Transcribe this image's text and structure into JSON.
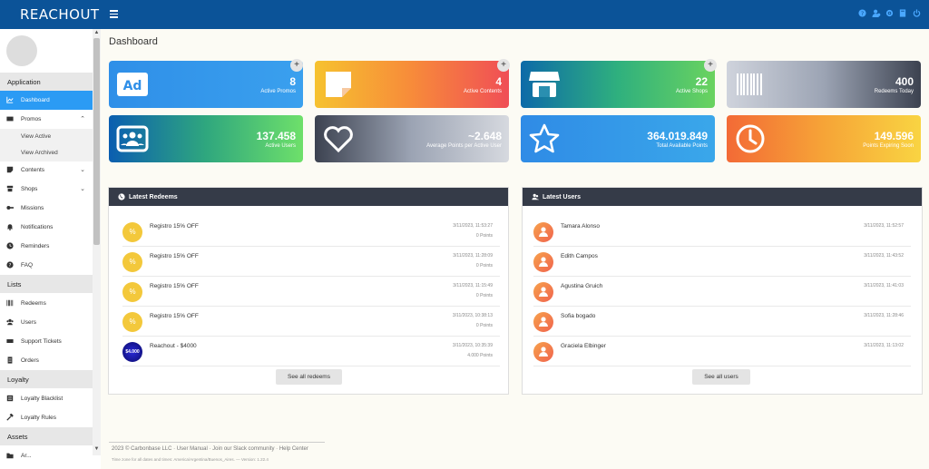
{
  "app": {
    "logo": "REACHOUT"
  },
  "topbar": {
    "icons": [
      "help-icon",
      "user-settings-icon",
      "gear-icon",
      "book-icon",
      "power-icon"
    ]
  },
  "sidebar": {
    "sections": {
      "application": "Application",
      "lists": "Lists",
      "loyalty": "Loyalty",
      "assets": "Assets"
    },
    "items": {
      "dashboard": "Dashboard",
      "promos": "Promos",
      "view_active": "View Active",
      "view_archived": "View Archived",
      "contents": "Contents",
      "shops": "Shops",
      "missions": "Missions",
      "notifications": "Notifications",
      "reminders": "Reminders",
      "faq": "FAQ",
      "redeems": "Redeems",
      "users": "Users",
      "support_tickets": "Support Tickets",
      "orders": "Orders",
      "loyalty_blacklist": "Loyalty Blacklist",
      "loyalty_rules": "Loyalty Rules",
      "assets_partial": "Ar..."
    }
  },
  "page": {
    "title": "Dashboard"
  },
  "cards": [
    {
      "value": "8",
      "label": "Active Promos",
      "icon_text": "Ad"
    },
    {
      "value": "4",
      "label": "Active Contents"
    },
    {
      "value": "22",
      "label": "Active Shops"
    },
    {
      "value": "400",
      "label": "Redeems Today"
    },
    {
      "value": "137.458",
      "label": "Active Users"
    },
    {
      "value": "~2.648",
      "label": "Average Points per Active User"
    },
    {
      "value": "364.019.849",
      "label": "Total Available Points"
    },
    {
      "value": "149.596",
      "label": "Points Expiring Soon"
    }
  ],
  "plus": "+",
  "latest_redeems": {
    "title": "Latest Redeems",
    "rows": [
      {
        "name": "Registro 15% OFF",
        "date": "3/11/2023, 11:53:27",
        "points": "0 Points",
        "icon": "%"
      },
      {
        "name": "Registro 15% OFF",
        "date": "3/11/2023, 11:28:09",
        "points": "0 Points",
        "icon": "%"
      },
      {
        "name": "Registro 15% OFF",
        "date": "3/11/2023, 11:15:49",
        "points": "0 Points",
        "icon": "%"
      },
      {
        "name": "Registro 15% OFF",
        "date": "3/11/2023, 10:38:13",
        "points": "0 Points",
        "icon": "%"
      },
      {
        "name": "Reachout - $4000",
        "date": "3/11/2023, 10:35:39",
        "points": "4.000 Points",
        "icon": "$4.000"
      }
    ],
    "button": "See all redeems"
  },
  "latest_users": {
    "title": "Latest Users",
    "rows": [
      {
        "name": "Tamara Alonso",
        "date": "3/11/2023, 11:52:57"
      },
      {
        "name": "Edith Campos",
        "date": "3/11/2023, 11:43:52"
      },
      {
        "name": "Agustina Gruich",
        "date": "3/11/2023, 11:41:03"
      },
      {
        "name": "Sofia bogado",
        "date": "3/11/2023, 11:28:46"
      },
      {
        "name": "Graciela Elbinger",
        "date": "3/11/2023, 11:13:02"
      }
    ],
    "button": "See all users"
  },
  "footer": {
    "line1": "2023 © Carbonbase LLC  · User Manual  · Join our Slack community  · Help Center",
    "line2": "Time zone for all dates and times: America/Argentina/Buenos_Aires. — Version: 1.22.4"
  }
}
